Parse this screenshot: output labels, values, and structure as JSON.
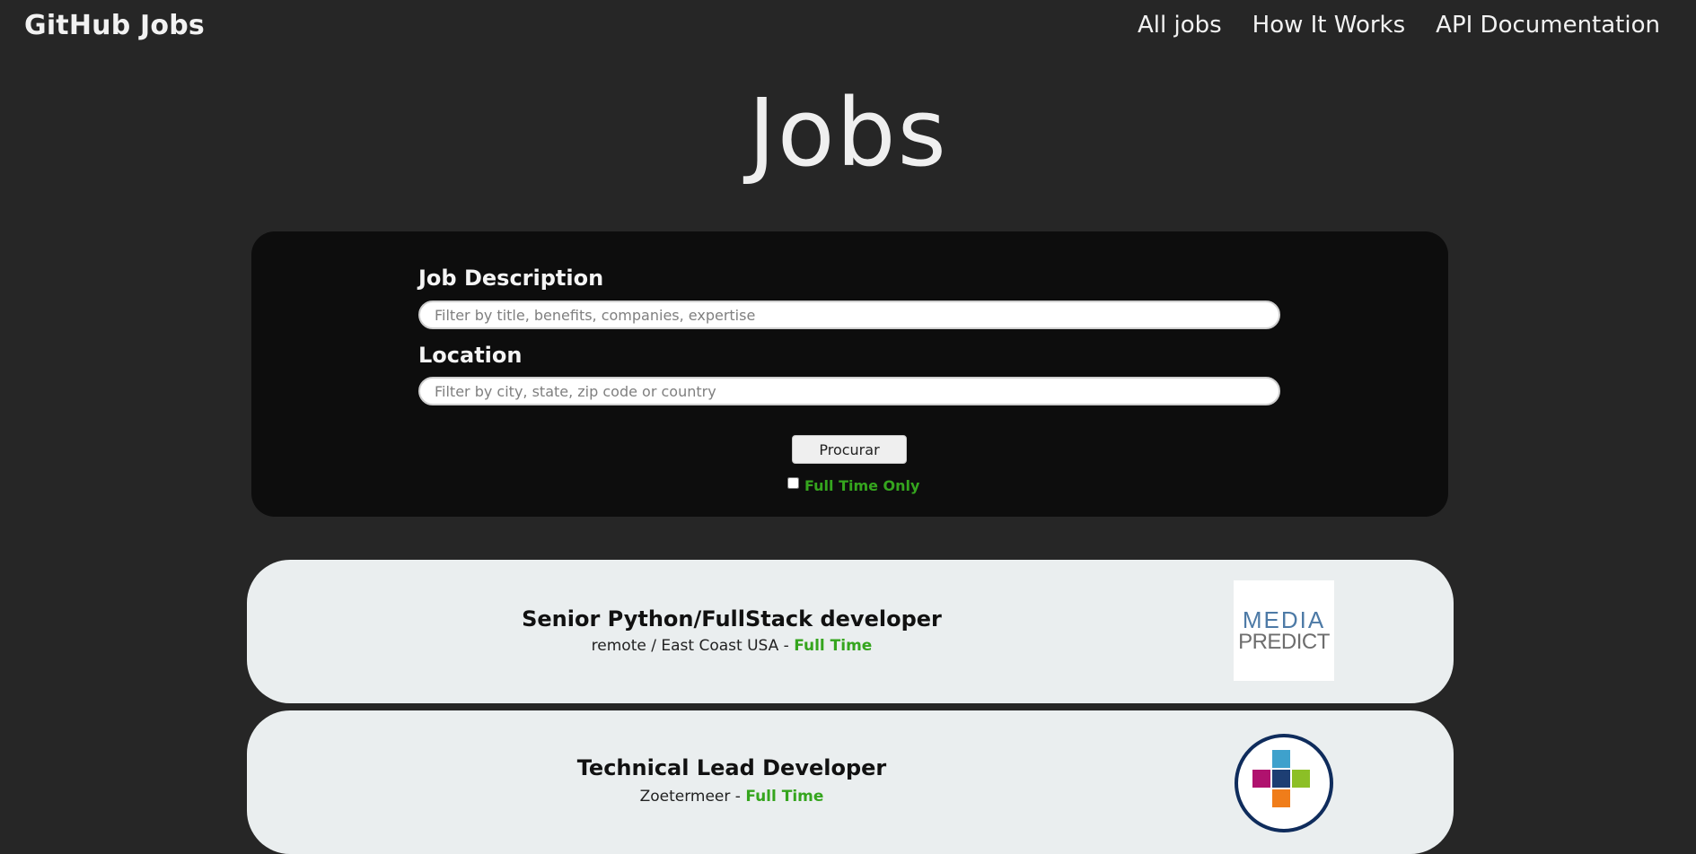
{
  "header": {
    "brand": "GitHub Jobs",
    "nav": [
      "All jobs",
      "How It Works",
      "API Documentation"
    ]
  },
  "page_title": "Jobs",
  "search": {
    "description_label": "Job Description",
    "description_placeholder": "Filter by title, benefits, companies, expertise",
    "location_label": "Location",
    "location_placeholder": "Filter by city, state, zip code or country",
    "button": "Procurar",
    "fulltime_label": "Full Time Only",
    "fulltime_checked": false
  },
  "jobs": [
    {
      "title": "Senior Python/FullStack developer",
      "location": "remote / East Coast USA",
      "separator": " - ",
      "type": "Full Time",
      "logo": {
        "line1": "MEDIA",
        "line2": "PREDICT"
      }
    },
    {
      "title": "Technical Lead Developer",
      "location": "Zoetermeer",
      "separator": " - ",
      "type": "Full Time",
      "logo": {
        "icon": "colored-cross-logo"
      }
    }
  ],
  "colors": {
    "background": "#262626",
    "panel": "#0d0d0d",
    "card": "#eaeeef",
    "accent_green": "#35a51e"
  }
}
